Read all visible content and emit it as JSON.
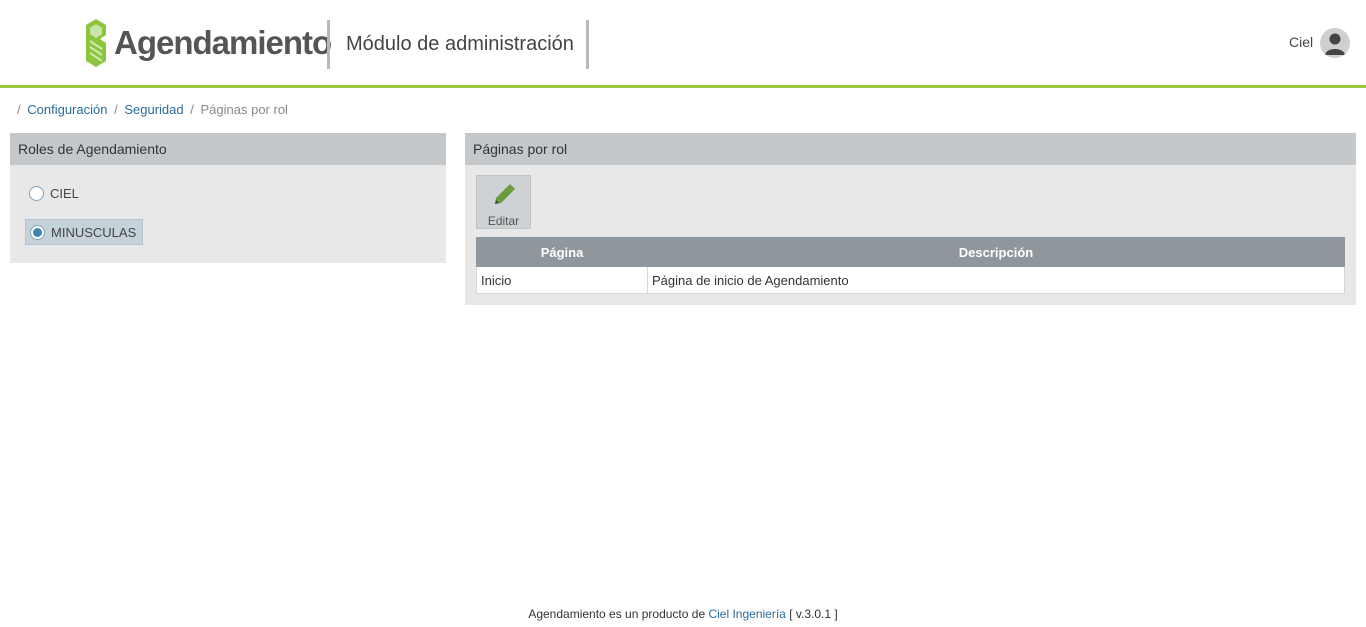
{
  "header": {
    "logo_text": "Agendamiento",
    "module_title": "Módulo de administración",
    "user_name": "Ciel"
  },
  "breadcrumb": {
    "items": [
      "Configuración",
      "Seguridad"
    ],
    "current": "Páginas por rol"
  },
  "roles_panel": {
    "title": "Roles de Agendamiento",
    "roles": [
      {
        "label": "CIEL",
        "selected": false
      },
      {
        "label": "MINUSCULAS",
        "selected": true
      }
    ]
  },
  "pages_panel": {
    "title": "Páginas por rol",
    "edit_label": "Editar",
    "table": {
      "columns": [
        "Página",
        "Descripción"
      ],
      "rows": [
        [
          "Inicio",
          "Página de inicio de Agendamiento"
        ]
      ]
    }
  },
  "footer": {
    "text_before": "Agendamiento es un producto de",
    "link_text": "Ciel Ingeniería",
    "version": "[ v.3.0.1 ]"
  },
  "colors": {
    "accent": "#9cc43c",
    "link": "#2a6d9b",
    "panel_header": "#c4c8cb",
    "table_header": "#8f979d"
  }
}
